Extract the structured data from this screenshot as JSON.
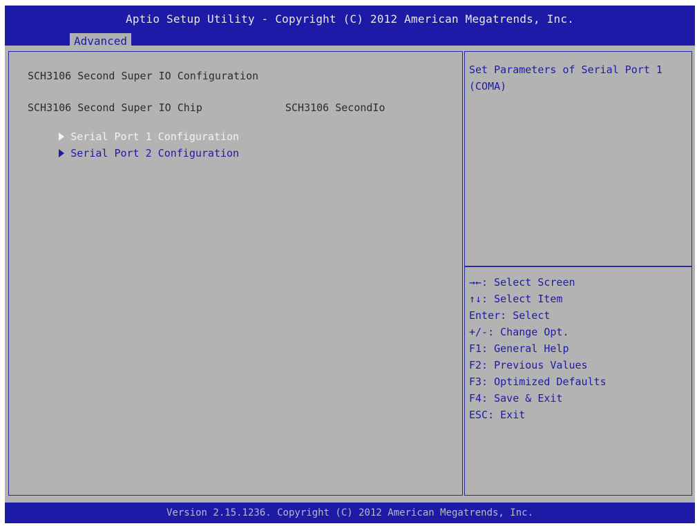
{
  "header": {
    "title": "Aptio Setup Utility - Copyright (C) 2012 American Megatrends, Inc.",
    "active_tab": "Advanced"
  },
  "main": {
    "section_title": "SCH3106 Second Super IO Configuration",
    "chip": {
      "label": "SCH3106 Second Super IO Chip",
      "value": "SCH3106 SecondIo"
    },
    "menu_items": [
      {
        "label": "Serial Port 1 Configuration",
        "selected": true
      },
      {
        "label": "Serial Port 2 Configuration",
        "selected": false
      }
    ]
  },
  "help": {
    "text": "Set Parameters of Serial Port 1 (COMA)"
  },
  "keys": [
    "→←: Select Screen",
    "↑↓: Select Item",
    "Enter: Select",
    "+/-: Change Opt.",
    "F1: General Help",
    "F2: Previous Values",
    "F3: Optimized Defaults",
    "F4: Save & Exit",
    "ESC: Exit"
  ],
  "footer": {
    "version": "Version 2.15.1236. Copyright (C) 2012 American Megatrends, Inc."
  },
  "colors": {
    "bar_blue": "#1d1aa8",
    "panel_gray": "#b3b3b3",
    "highlight_white": "#f2f2f2"
  },
  "icons": {
    "submenu": "triangle-right-icon"
  }
}
